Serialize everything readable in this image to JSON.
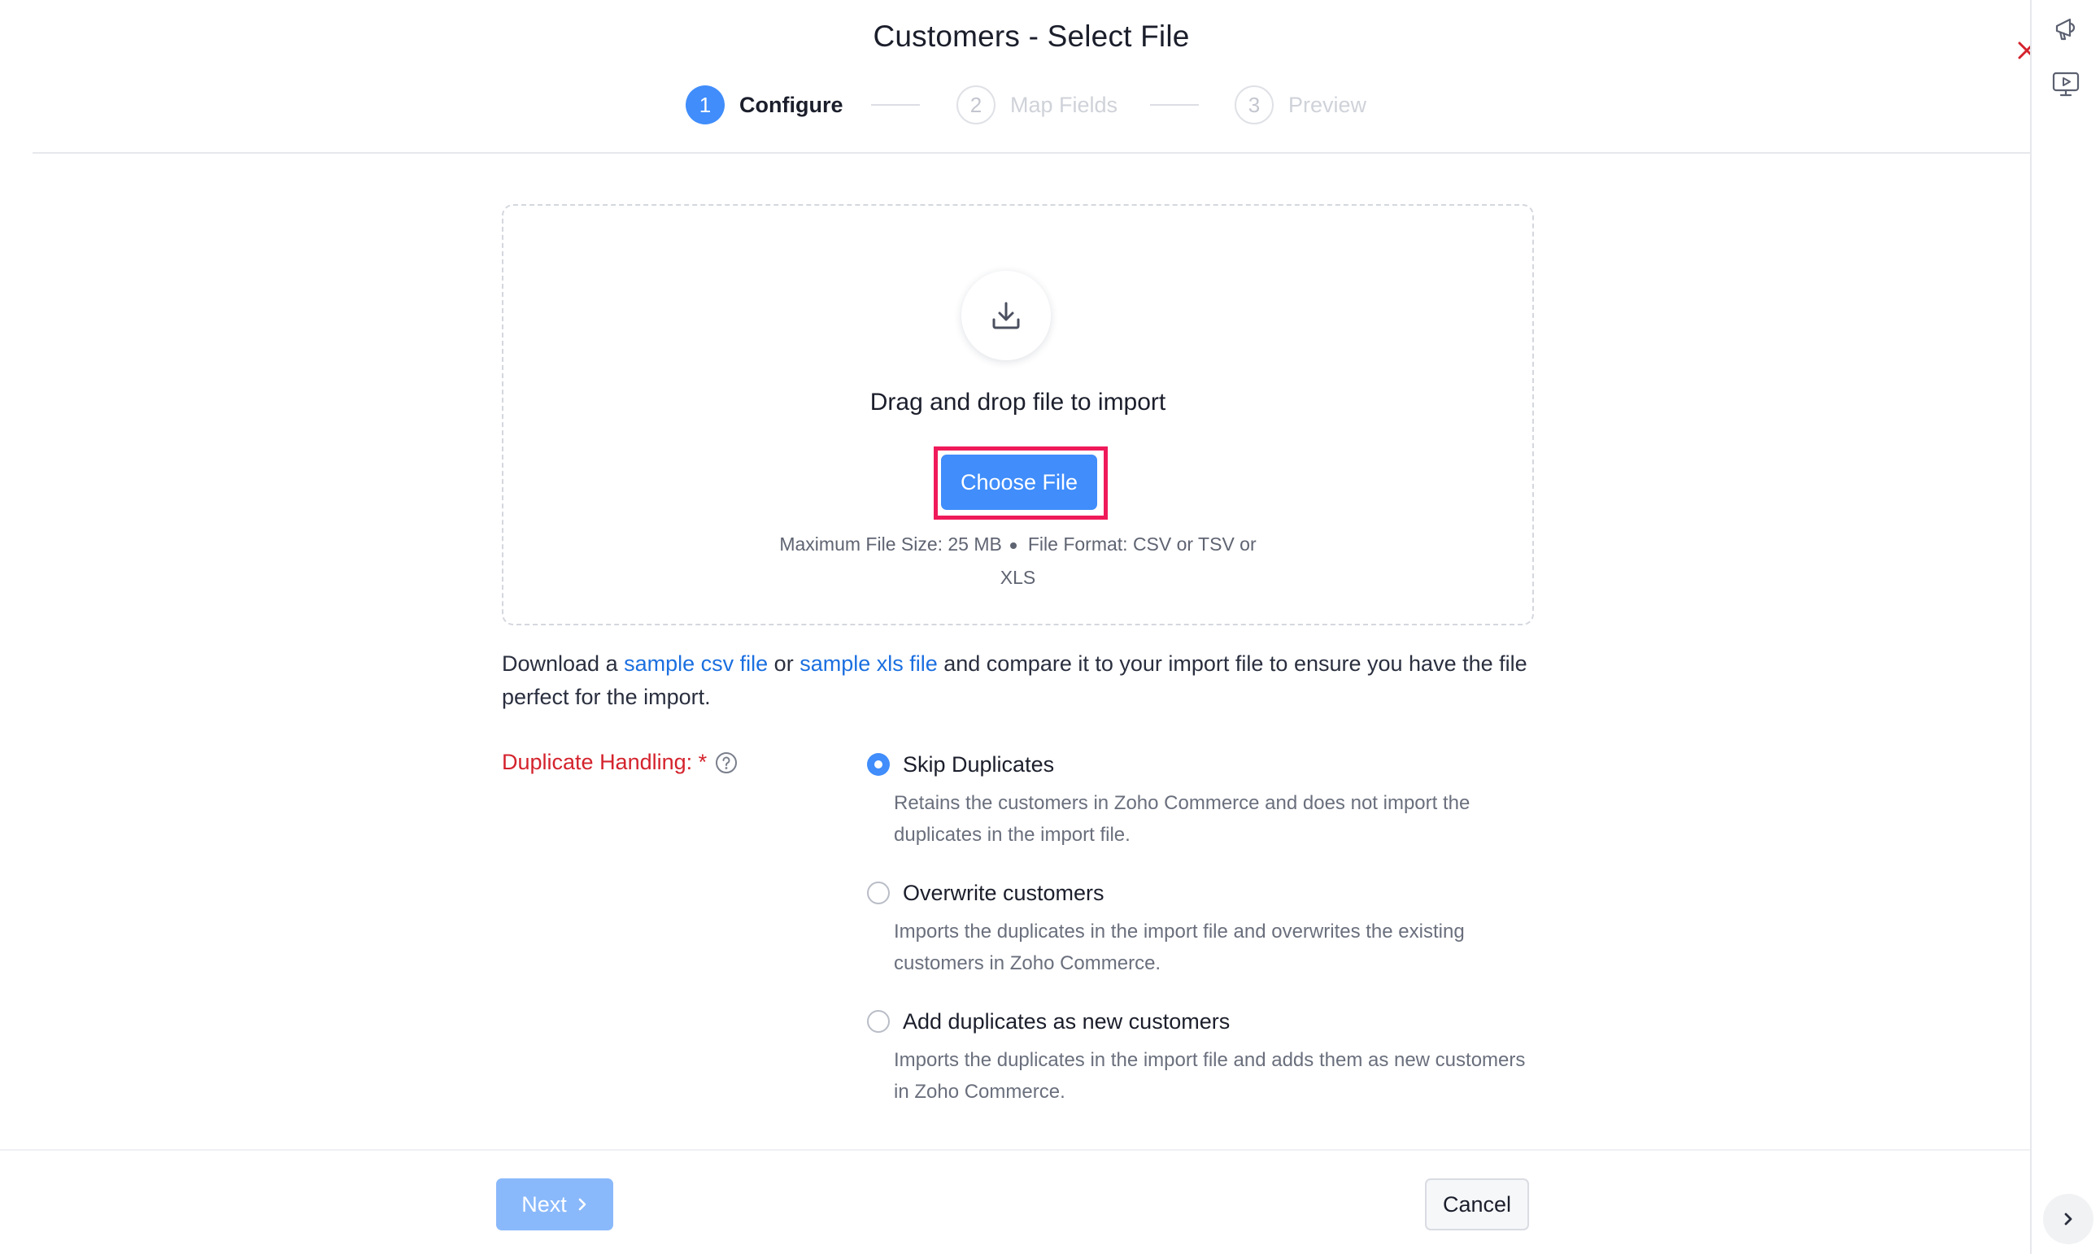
{
  "header": {
    "title": "Customers - Select File",
    "steps": [
      {
        "number": "1",
        "label": "Configure",
        "state": "active"
      },
      {
        "number": "2",
        "label": "Map Fields",
        "state": "inactive"
      },
      {
        "number": "3",
        "label": "Preview",
        "state": "inactive"
      }
    ],
    "close_icon": "close-icon"
  },
  "right_rail": {
    "icons": [
      "announcement-icon",
      "video-tutorial-icon",
      "chevron-right-icon"
    ]
  },
  "dropzone": {
    "icon": "download-icon",
    "heading": "Drag and drop file to import",
    "button_label": "Choose File",
    "max_size_text": "Maximum File Size: 25 MB",
    "format_text": "File Format: CSV or TSV or",
    "format_text_cont": "XLS"
  },
  "download_note": {
    "prefix": "Download a ",
    "csv_link": "sample csv file",
    "middle": " or ",
    "xls_link": "sample xls file",
    "suffix": " and compare it to your import file to ensure you have the file perfect for the import."
  },
  "duplicate_handling": {
    "label": "Duplicate Handling: *",
    "options": [
      {
        "label": "Skip Duplicates",
        "description": "Retains the customers in Zoho Commerce and does not import the duplicates in the import file.",
        "checked": true
      },
      {
        "label": "Overwrite customers",
        "description": "Imports the duplicates in the import file and overwrites the existing customers in Zoho Commerce.",
        "checked": false
      },
      {
        "label": "Add duplicates as new customers",
        "description": "Imports the duplicates in the import file and adds them as new customers in Zoho Commerce.",
        "checked": false
      }
    ]
  },
  "footer": {
    "next_label": "Next",
    "cancel_label": "Cancel"
  },
  "colors": {
    "accent": "#408dfb",
    "link": "#1b6fe0",
    "required_label": "#d4232d",
    "highlight_box": "#ef1a5a",
    "close_icon": "#d4232d"
  }
}
